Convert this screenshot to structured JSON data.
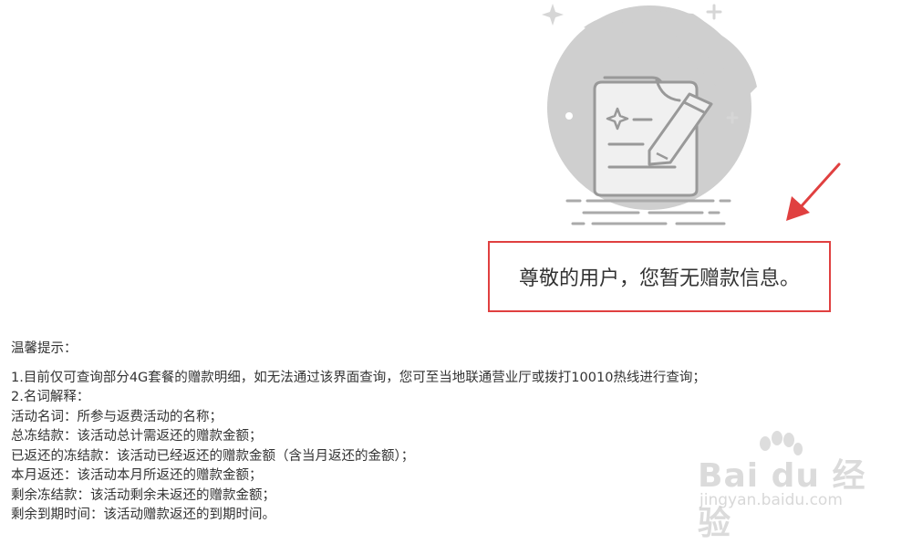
{
  "empty_state": {
    "message": "尊敬的用户，您暂无赠款信息。"
  },
  "tips": {
    "title": "温馨提示：",
    "lines": [
      "1.目前仅可查询部分4G套餐的赠款明细，如无法通过该界面查询，您可至当地联通营业厅或拨打10010热线进行查询；",
      "2.名词解释：",
      "活动名词：所参与返费活动的名称；",
      "总冻结款：该活动总计需返还的赠款金额；",
      "已返还的冻结款：该活动已经返还的赠款金额（含当月返还的金额）；",
      "本月返还：该活动本月所返还的赠款金额；",
      "剩余冻结款：该活动剩余未返还的赠款金额；",
      "剩余到期时间：该活动赠款返还的到期时间。"
    ]
  },
  "watermark": {
    "logo": "Bai du 经验",
    "url": "jingyan.baidu.com"
  },
  "colors": {
    "accent_red": "#e04040",
    "illustration_gray": "#cccccc"
  },
  "icons": [
    "document-pencil-icon",
    "sparkle-icon",
    "plus-icon",
    "arrow-icon",
    "paw-icon"
  ]
}
